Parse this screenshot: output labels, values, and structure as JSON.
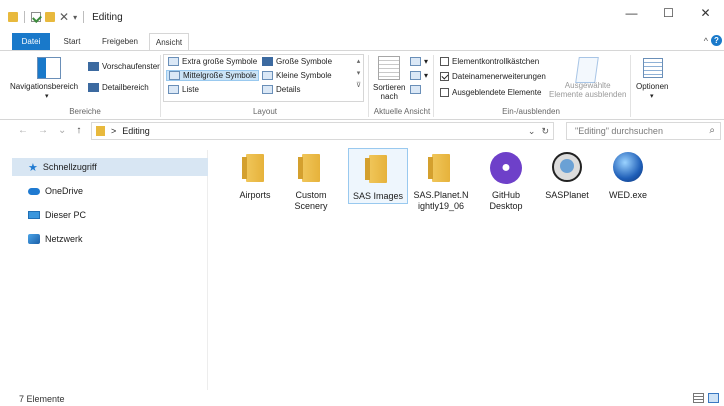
{
  "window": {
    "title": "Editing"
  },
  "window_buttons": {
    "minimize": "—",
    "maximize": "☐",
    "close": "✕"
  },
  "tabs": {
    "datei": "Datei",
    "start": "Start",
    "freigeben": "Freigeben",
    "ansicht": "Ansicht"
  },
  "ribbon_toggle": "^",
  "help": "?",
  "ribbon": {
    "bereiche": {
      "nav_pane": "Navigationsbereich",
      "preview": "Vorschaufenster",
      "details": "Detailbereich",
      "label": "Bereiche"
    },
    "layout": {
      "extra_large": "Extra große Symbole",
      "large": "Große Symbole",
      "medium": "Mittelgroße Symbole",
      "small": "Kleine Symbole",
      "list": "Liste",
      "details": "Details",
      "label": "Layout"
    },
    "current_view": {
      "sort_line1": "Sortieren",
      "sort_line2": "nach",
      "label": "Aktuelle Ansicht"
    },
    "show_hide": {
      "item_checkboxes": "Elementkontrollkästchen",
      "file_extensions": "Dateinamenerweiterungen",
      "hidden_items": "Ausgeblendete Elemente",
      "hide_selected_line1": "Ausgewählte",
      "hide_selected_line2": "Elemente ausblenden",
      "label": "Ein-/ausblenden",
      "item_checkboxes_checked": false,
      "file_extensions_checked": true,
      "hidden_items_checked": false
    },
    "options": {
      "label": "Optionen"
    }
  },
  "address": {
    "back": "←",
    "forward": "→",
    "recent": "⌄",
    "up": "↑",
    "path_sep": ">",
    "path": "Editing",
    "dropdown": "⌄",
    "refresh": "↻",
    "search_placeholder": "\"Editing\" durchsuchen",
    "search_icon": "⌕"
  },
  "sidebar": {
    "items": [
      {
        "label": "Schnellzugriff",
        "icon": "star-icon"
      },
      {
        "label": "OneDrive",
        "icon": "cloud-icon"
      },
      {
        "label": "Dieser PC",
        "icon": "pc-icon"
      },
      {
        "label": "Netzwerk",
        "icon": "network-icon"
      }
    ]
  },
  "files": [
    {
      "label": "Airports",
      "icon": "folder-icon"
    },
    {
      "label": "Custom Scenery",
      "icon": "folder-icon"
    },
    {
      "label": "SAS Images",
      "icon": "folder-icon"
    },
    {
      "label": "SAS.Planet.Nightly19_06",
      "icon": "folder-icon"
    },
    {
      "label": "GitHub Desktop",
      "icon": "github-icon"
    },
    {
      "label": "SASPlanet",
      "icon": "sasplanet-icon"
    },
    {
      "label": "WED.exe",
      "icon": "wed-icon"
    }
  ],
  "status": {
    "count": "7 Elemente"
  },
  "colors": {
    "accent": "#1979ca",
    "folder": "#e8b93d",
    "selection": "#cce4f7"
  }
}
